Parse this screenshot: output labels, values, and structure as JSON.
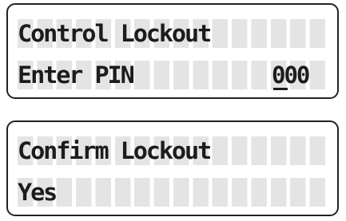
{
  "screens": [
    {
      "line1": "Control Lockout",
      "line2": "Enter PIN",
      "pin": "000"
    },
    {
      "line1": "Confirm Lockout",
      "line2": "Yes"
    }
  ]
}
